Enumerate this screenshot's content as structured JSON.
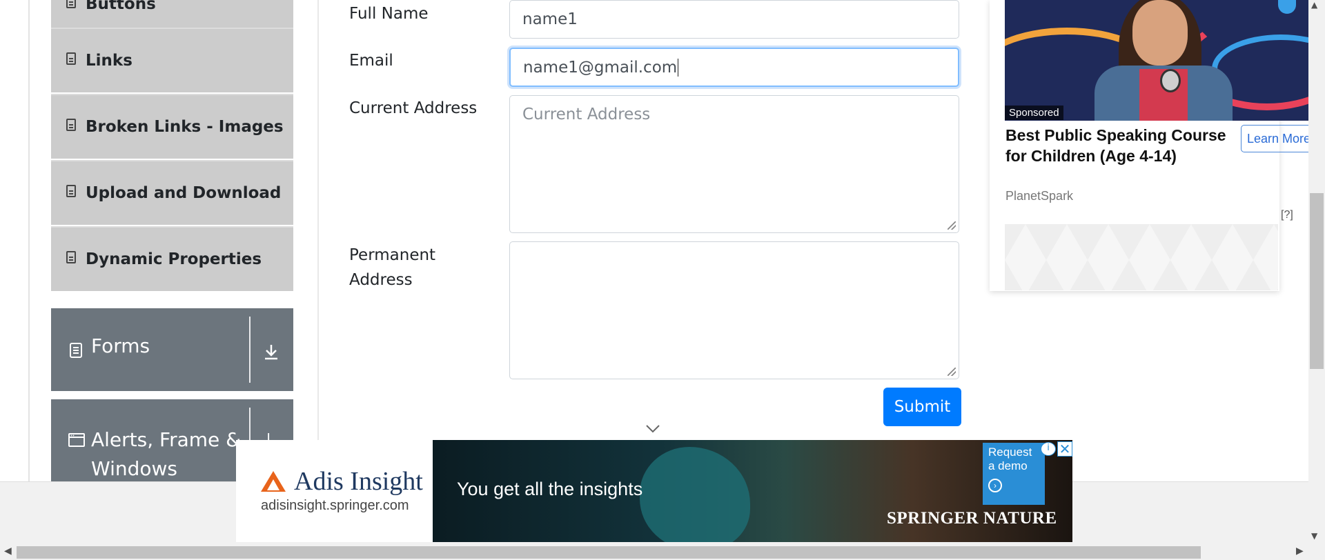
{
  "sidebar": {
    "elements_items": [
      {
        "label": "Buttons"
      },
      {
        "label": "Links"
      },
      {
        "label": "Broken Links - Images"
      },
      {
        "label": "Upload and Download"
      },
      {
        "label": "Dynamic Properties"
      }
    ],
    "groups": [
      {
        "label": "Forms",
        "icon": "form-icon"
      },
      {
        "label": "Alerts, Frame & Windows",
        "icon": "window-icon"
      }
    ]
  },
  "form": {
    "full_name": {
      "label": "Full Name",
      "value": "name1"
    },
    "email": {
      "label": "Email",
      "value": "name1@gmail.com"
    },
    "current_address": {
      "label": "Current Address",
      "placeholder": "Current Address",
      "value": ""
    },
    "permanent_address": {
      "label": "Permanent Address",
      "value": ""
    },
    "submit_label": "Submit"
  },
  "side_ad": {
    "badge": "Sponsored",
    "title": "Best Public Speaking Course for Children (Age 4-14)",
    "brand": "PlanetSpark",
    "cta": "Learn More",
    "help": "[?]"
  },
  "bottom_ad": {
    "brand": "Adis Insight",
    "url": "adisinsight.springer.com",
    "headline": "You get all the insights",
    "cta": "Request a demo",
    "publisher": "SPRINGER NATURE",
    "close": "✕",
    "info": "i"
  },
  "colors": {
    "primary": "#007bff",
    "sidebar_item_bg": "#cccccc",
    "group_head_bg": "#6c757d",
    "focus_ring": "#80bdff"
  }
}
